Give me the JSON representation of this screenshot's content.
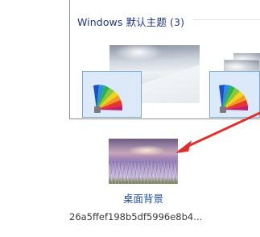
{
  "theme_section": {
    "title": "Windows 默认主题 (3)",
    "themes": [
      {
        "icon": "windows-theme-icon",
        "selected": true
      },
      {
        "icon": "windows-theme-icon",
        "selected": true
      }
    ]
  },
  "desktop_background": {
    "label": "桌面背景",
    "filename": "26a5ffef198b5df5996e8b4..."
  },
  "annotation": {
    "type": "arrow",
    "color": "#e0302b"
  },
  "colors": {
    "header_text": "#1e3287",
    "link_text": "#1e4f9a",
    "selection_fill": "#dbe9f8"
  }
}
